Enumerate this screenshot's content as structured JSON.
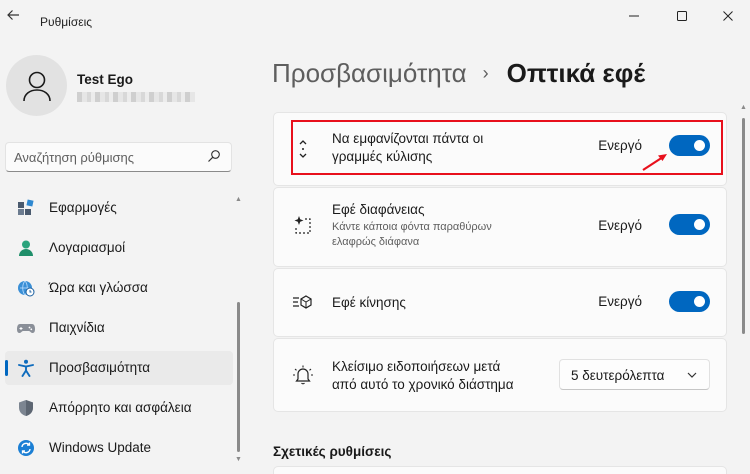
{
  "app": {
    "title": "Ρυθμίσεις"
  },
  "user": {
    "name": "Test Ego"
  },
  "search": {
    "placeholder": "Αναζήτηση ρύθμισης"
  },
  "sidebar": {
    "items": [
      {
        "label": "Εφαρμογές",
        "icon": "apps-icon"
      },
      {
        "label": "Λογαριασμοί",
        "icon": "accounts-icon"
      },
      {
        "label": "Ώρα και γλώσσα",
        "icon": "time-language-icon"
      },
      {
        "label": "Παιχνίδια",
        "icon": "gaming-icon"
      },
      {
        "label": "Προσβασιμότητα",
        "icon": "accessibility-icon",
        "active": true
      },
      {
        "label": "Απόρρητο και ασφάλεια",
        "icon": "privacy-shield-icon"
      },
      {
        "label": "Windows Update",
        "icon": "windows-update-icon"
      }
    ]
  },
  "breadcrumb": {
    "parent": "Προσβασιμότητα",
    "separator": "›",
    "current": "Οπτικά εφέ"
  },
  "settings": {
    "scrollbars": {
      "title_line1": "Να εμφανίζονται πάντα οι",
      "title_line2": "γραμμές κύλισης",
      "state": "Ενεργό",
      "on": true
    },
    "transparency": {
      "title": "Εφέ διαφάνειας",
      "sub_line1": "Κάντε κάποια φόντα παραθύρων",
      "sub_line2": "ελαφρώς διάφανα",
      "state": "Ενεργό",
      "on": true
    },
    "animation": {
      "title": "Εφέ κίνησης",
      "state": "Ενεργό",
      "on": true
    },
    "notifications": {
      "title_line1": "Κλείσιμο ειδοποιήσεων μετά",
      "title_line2": "από αυτό το χρονικό διάστημα",
      "selected": "5 δευτερόλεπτα"
    }
  },
  "related": {
    "heading": "Σχετικές ρυθμίσεις"
  },
  "colors": {
    "accent": "#0067c0",
    "highlight": "#e8101c",
    "background": "#f3f3f3",
    "card": "#fbfbfb"
  }
}
